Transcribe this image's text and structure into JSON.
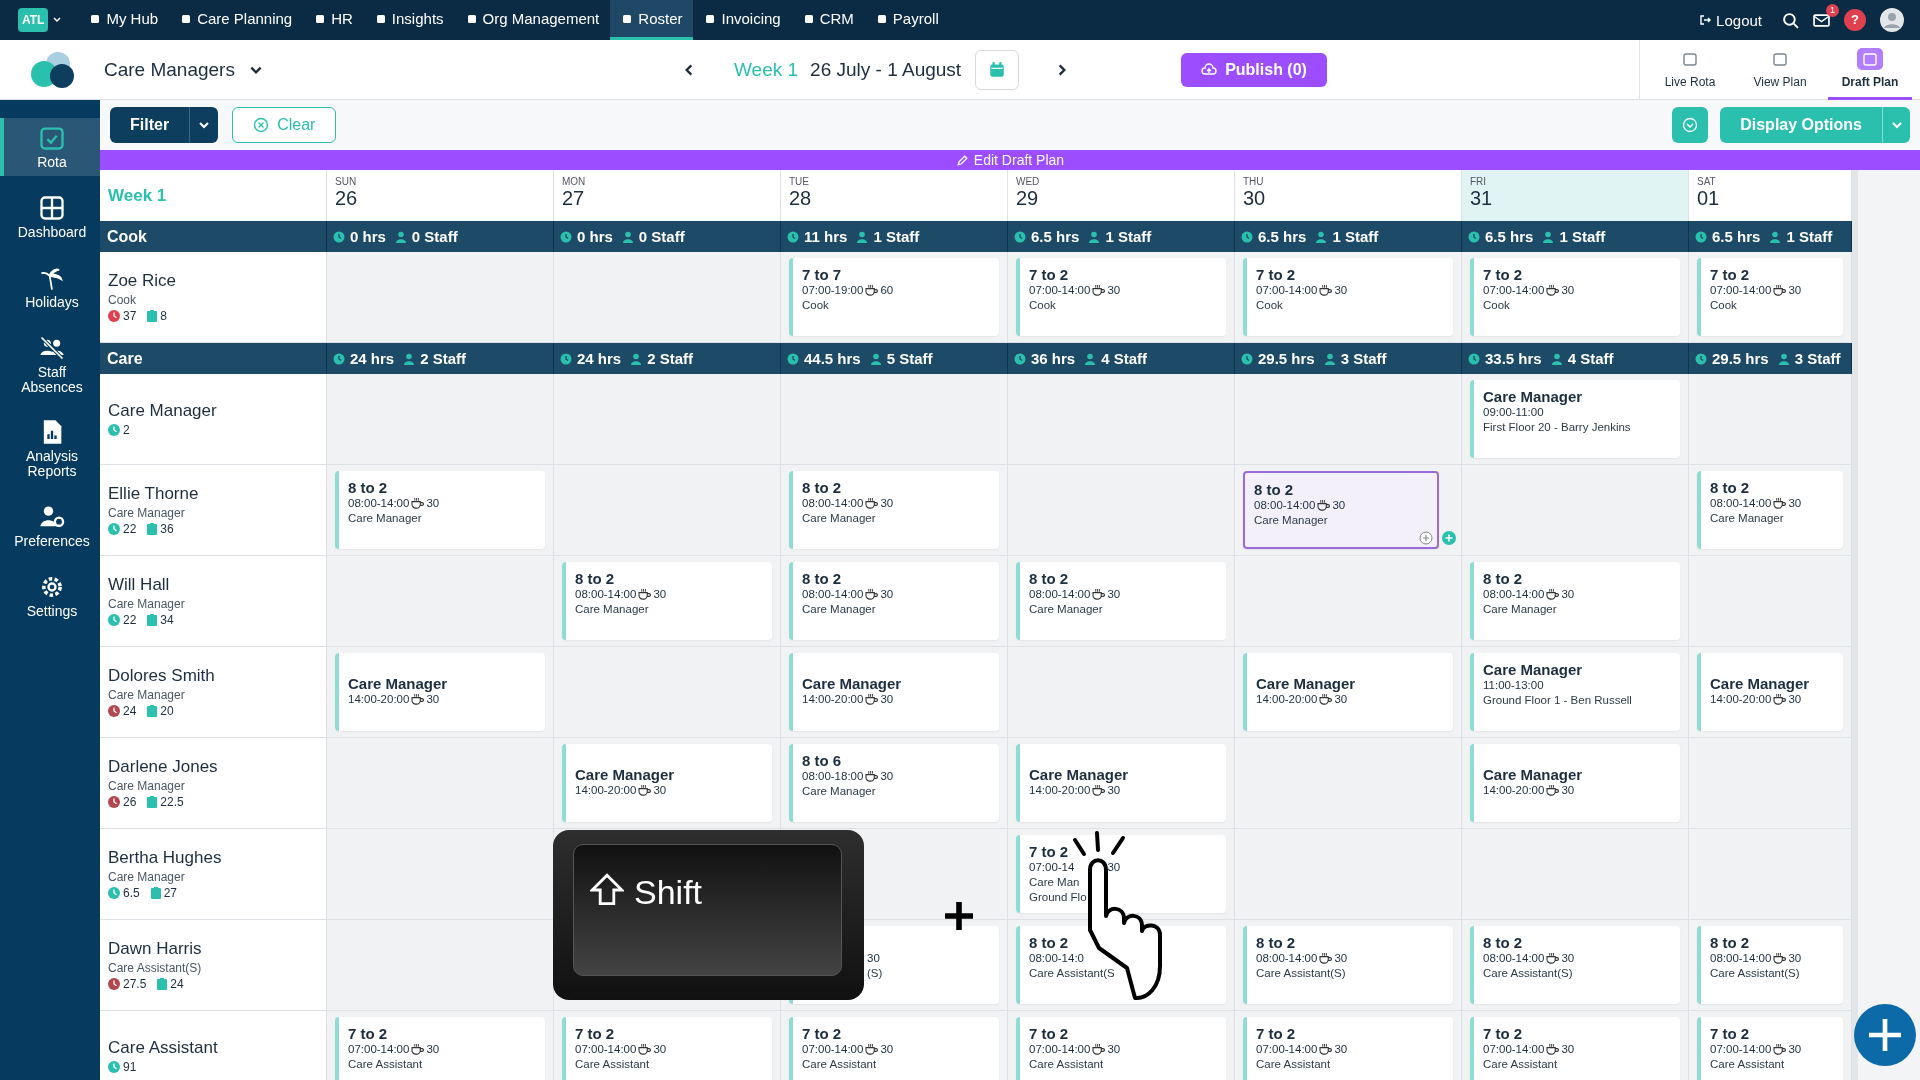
{
  "top_nav": {
    "org_badge": "ATL",
    "items": [
      {
        "label": "My Hub",
        "selected": false
      },
      {
        "label": "Care Planning",
        "selected": false
      },
      {
        "label": "HR",
        "selected": false
      },
      {
        "label": "Insights",
        "selected": false
      },
      {
        "label": "Org Management",
        "selected": false
      },
      {
        "label": "Roster",
        "selected": true
      },
      {
        "label": "Invoicing",
        "selected": false
      },
      {
        "label": "CRM",
        "selected": false
      },
      {
        "label": "Payroll",
        "selected": false
      }
    ],
    "logout": "Logout",
    "mail_badge": "1",
    "help": "?"
  },
  "header": {
    "team": "Care Managers",
    "week": "Week 1",
    "range": "26 July - 1 August",
    "publish": "Publish (0)",
    "views": [
      {
        "label": "Live Rota",
        "selected": false
      },
      {
        "label": "View Plan",
        "selected": false
      },
      {
        "label": "Draft Plan",
        "selected": true
      }
    ]
  },
  "sidebar": [
    {
      "label": "Rota",
      "selected": true
    },
    {
      "label": "Dashboard",
      "selected": false
    },
    {
      "label": "Holidays",
      "selected": false
    },
    {
      "label": "Staff Absences",
      "selected": false
    },
    {
      "label": "Analysis Reports",
      "selected": false
    },
    {
      "label": "Preferences",
      "selected": false
    },
    {
      "label": "Settings",
      "selected": false
    }
  ],
  "toolbar": {
    "filter": "Filter",
    "clear": "Clear",
    "display_options": "Display Options"
  },
  "banner": "Edit Draft Plan",
  "week_label": "Week 1",
  "days": [
    {
      "dow": "SUN",
      "date": "26",
      "today": false
    },
    {
      "dow": "MON",
      "date": "27",
      "today": false
    },
    {
      "dow": "TUE",
      "date": "28",
      "today": false
    },
    {
      "dow": "WED",
      "date": "29",
      "today": false
    },
    {
      "dow": "THU",
      "date": "30",
      "today": false
    },
    {
      "dow": "FRI",
      "date": "31",
      "today": true
    },
    {
      "dow": "SAT",
      "date": "01",
      "today": false
    }
  ],
  "groups": [
    {
      "name": "Cook",
      "totals": [
        {
          "hrs": "0 hrs",
          "staff": "0 Staff"
        },
        {
          "hrs": "0 hrs",
          "staff": "0 Staff"
        },
        {
          "hrs": "11 hrs",
          "staff": "1 Staff"
        },
        {
          "hrs": "6.5 hrs",
          "staff": "1 Staff"
        },
        {
          "hrs": "6.5 hrs",
          "staff": "1 Staff"
        },
        {
          "hrs": "6.5 hrs",
          "staff": "1 Staff"
        },
        {
          "hrs": "6.5 hrs",
          "staff": "1 Staff"
        }
      ],
      "rows": [
        {
          "name": "Zoe Rice",
          "role": "Cook",
          "hours": "37",
          "color": "#e0414f",
          "tasks": "8",
          "cells": [
            null,
            null,
            {
              "title": "7 to 7",
              "time": "07:00-19:00",
              "break": "60",
              "role": "Cook",
              "selected": false
            },
            {
              "title": "7 to 2",
              "time": "07:00-14:00",
              "break": "30",
              "role": "Cook",
              "selected": false
            },
            {
              "title": "7 to 2",
              "time": "07:00-14:00",
              "break": "30",
              "role": "Cook",
              "selected": false
            },
            {
              "title": "7 to 2",
              "time": "07:00-14:00",
              "break": "30",
              "role": "Cook",
              "selected": false
            },
            {
              "title": "7 to 2",
              "time": "07:00-14:00",
              "break": "30",
              "role": "Cook",
              "selected": false
            }
          ]
        }
      ]
    },
    {
      "name": "Care",
      "totals": [
        {
          "hrs": "24 hrs",
          "staff": "2 Staff"
        },
        {
          "hrs": "24 hrs",
          "staff": "2 Staff"
        },
        {
          "hrs": "44.5 hrs",
          "staff": "5 Staff"
        },
        {
          "hrs": "36 hrs",
          "staff": "4 Staff"
        },
        {
          "hrs": "29.5 hrs",
          "staff": "3 Staff"
        },
        {
          "hrs": "33.5 hrs",
          "staff": "4 Staff"
        },
        {
          "hrs": "29.5 hrs",
          "staff": "3 Staff"
        }
      ],
      "rows": [
        {
          "name": "Care Manager",
          "hours": "2",
          "color": "#2bbfae",
          "cells": [
            null,
            null,
            null,
            null,
            null,
            {
              "title": "Care Manager",
              "time": "09:00-11:00",
              "note": "First Floor 20 - Barry Jenkins",
              "selected": false
            },
            null
          ]
        },
        {
          "name": "Ellie Thorne",
          "role": "Care Manager",
          "hours": "22",
          "color": "#2bbfae",
          "tasks": "36",
          "cells": [
            {
              "title": "8 to 2",
              "time": "08:00-14:00",
              "break": "30",
              "role": "Care Manager",
              "selected": false
            },
            null,
            {
              "title": "8 to 2",
              "time": "08:00-14:00",
              "break": "30",
              "role": "Care Manager",
              "selected": false
            },
            null,
            {
              "title": "8 to 2",
              "time": "08:00-14:00",
              "break": "30",
              "role": "Care Manager",
              "selected": true
            },
            null,
            {
              "title": "8 to 2",
              "time": "08:00-14:00",
              "break": "30",
              "role": "Care Manager",
              "selected": false
            }
          ]
        },
        {
          "name": "Will Hall",
          "role": "Care Manager",
          "hours": "22",
          "color": "#2bbfae",
          "tasks": "34",
          "cells": [
            null,
            {
              "title": "8 to 2",
              "time": "08:00-14:00",
              "break": "30",
              "role": "Care Manager",
              "selected": false
            },
            {
              "title": "8 to 2",
              "time": "08:00-14:00",
              "break": "30",
              "role": "Care Manager",
              "selected": false
            },
            {
              "title": "8 to 2",
              "time": "08:00-14:00",
              "break": "30",
              "role": "Care Manager",
              "selected": false
            },
            null,
            {
              "title": "8 to 2",
              "time": "08:00-14:00",
              "break": "30",
              "role": "Care Manager",
              "selected": false
            },
            null
          ]
        },
        {
          "name": "Dolores Smith",
          "role": "Care Manager",
          "hours": "24",
          "color": "#b2474f",
          "tasks": "20",
          "cells": [
            {
              "title": "Care Manager",
              "time": "14:00-20:00",
              "break": "30",
              "selected": false
            },
            null,
            {
              "title": "Care Manager",
              "time": "14:00-20:00",
              "break": "30",
              "selected": false
            },
            null,
            {
              "title": "Care Manager",
              "time": "14:00-20:00",
              "break": "30",
              "selected": false
            },
            {
              "title": "Care Manager",
              "time": "11:00-13:00",
              "note": "Ground Floor 1 - Ben Russell",
              "selected": false
            },
            {
              "title": "Care Manager",
              "time": "14:00-20:00",
              "break": "30",
              "selected": false
            }
          ]
        },
        {
          "name": "Darlene Jones",
          "role": "Care Manager",
          "hours": "26",
          "color": "#b2474f",
          "tasks": "22.5",
          "cells": [
            null,
            {
              "title": "Care Manager",
              "time": "14:00-20:00",
              "break": "30",
              "selected": false
            },
            {
              "title": "8 to 6",
              "time": "08:00-18:00",
              "break": "30",
              "role": "Care Manager",
              "selected": false
            },
            {
              "title": "Care Manager",
              "time": "14:00-20:00",
              "break": "30",
              "selected": false
            },
            null,
            {
              "title": "Care Manager",
              "time": "14:00-20:00",
              "break": "30",
              "selected": false
            },
            null
          ]
        },
        {
          "name": "Bertha Hughes",
          "role": "Care Manager",
          "hours": "6.5",
          "color": "#2bbfae",
          "tasks": "27",
          "cells": [
            null,
            null,
            null,
            {
              "kind": "obscured",
              "title": "7 to 2",
              "time": "07:00-14",
              "break": "30",
              "role": "Care Man",
              "note": "Ground Flo",
              "selected": false
            },
            null,
            null,
            null
          ]
        },
        {
          "name": "Dawn Harris",
          "role": "Care Assistant(S)",
          "hours": "27.5",
          "color": "#b2474f",
          "tasks": "24",
          "cells": [
            null,
            null,
            {
              "kind": "covered",
              "break": "30",
              "role": "(S)",
              "selected": false
            },
            {
              "title": "8 to 2",
              "time": "08:00-14:0",
              "role": "Care Assistant(S",
              "selected": false
            },
            {
              "title": "8 to 2",
              "time": "08:00-14:00",
              "break": "30",
              "role": "Care Assistant(S)",
              "selected": false
            },
            {
              "title": "8 to 2",
              "time": "08:00-14:00",
              "break": "30",
              "role": "Care Assistant(S)",
              "selected": false
            },
            {
              "title": "8 to 2",
              "time": "08:00-14:00",
              "break": "30",
              "role": "Care Assistant(S)",
              "selected": false
            }
          ]
        },
        {
          "name": "Care Assistant",
          "hours": "91",
          "color": "#2bbfae",
          "cells": [
            {
              "title": "7 to 2",
              "time": "07:00-14:00",
              "break": "30",
              "role": "Care Assistant",
              "selected": false
            },
            {
              "title": "7 to 2",
              "time": "07:00-14:00",
              "break": "30",
              "role": "Care Assistant",
              "selected": false
            },
            {
              "title": "7 to 2",
              "time": "07:00-14:00",
              "break": "30",
              "role": "Care Assistant",
              "selected": false
            },
            {
              "title": "7 to 2",
              "time": "07:00-14:00",
              "break": "30",
              "role": "Care Assistant",
              "selected": false
            },
            {
              "title": "7 to 2",
              "time": "07:00-14:00",
              "break": "30",
              "role": "Care Assistant",
              "selected": false
            },
            {
              "title": "7 to 2",
              "time": "07:00-14:00",
              "break": "30",
              "role": "Care Assistant",
              "selected": false
            },
            {
              "title": "7 to 2",
              "time": "07:00-14:00",
              "break": "30",
              "role": "Care Assistant",
              "selected": false
            }
          ]
        }
      ]
    }
  ],
  "overlay": {
    "key_label": "Shift"
  }
}
